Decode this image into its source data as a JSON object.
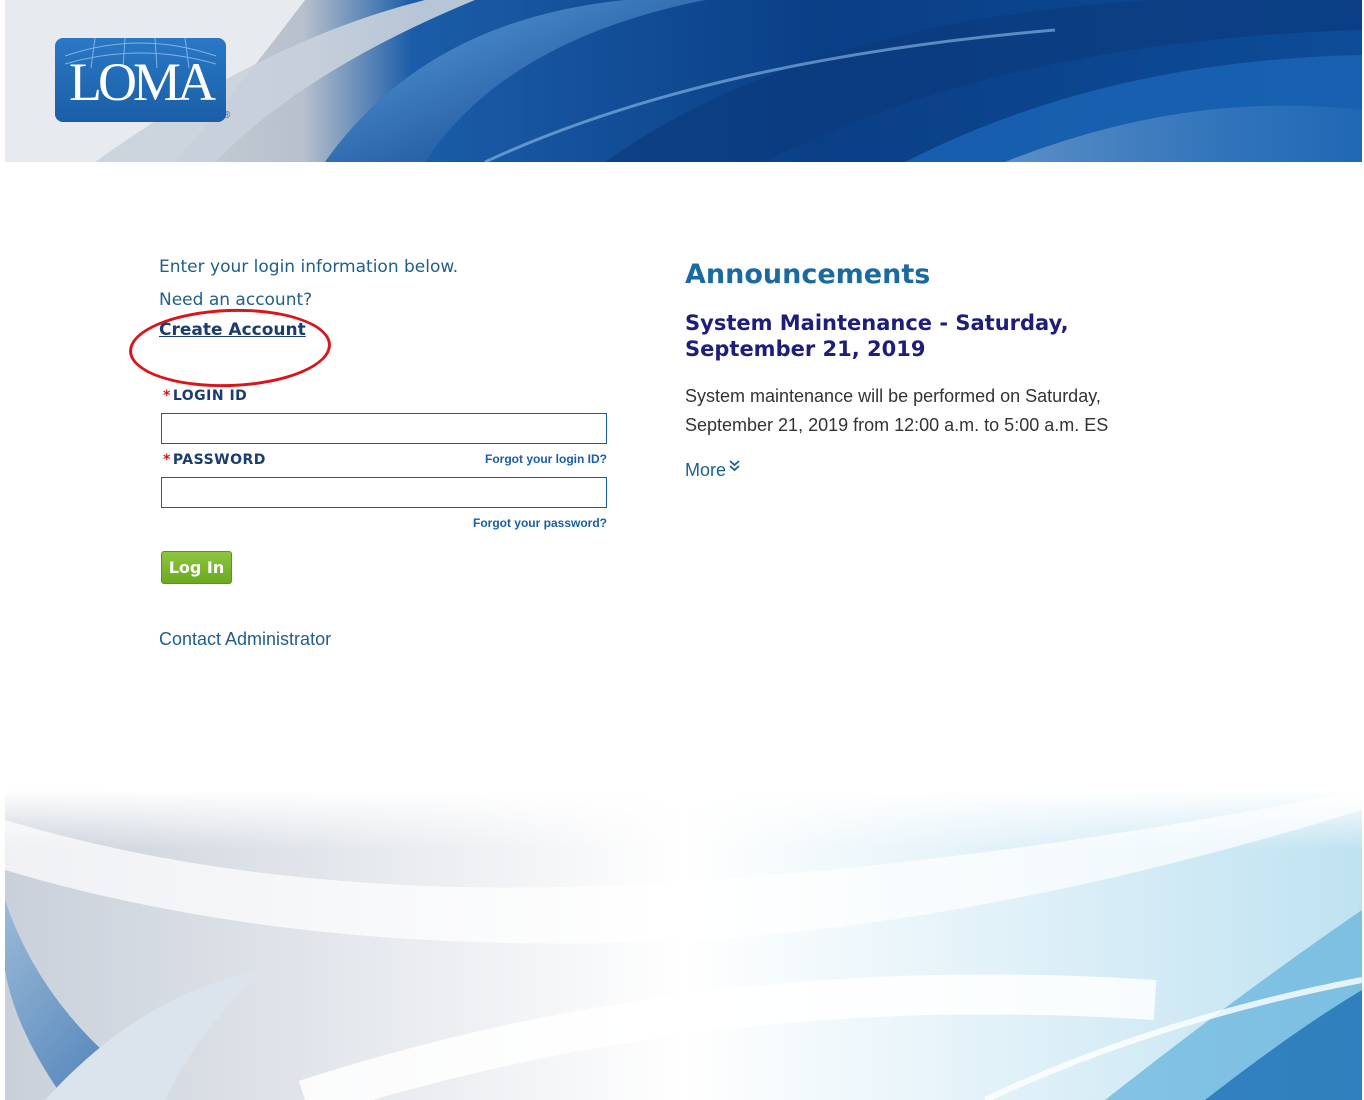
{
  "brand": {
    "logo_text": "LOMA",
    "reg_mark": "®"
  },
  "login": {
    "intro": "Enter your login information below.",
    "need_account": "Need an account?",
    "create_account": "Create Account",
    "login_id_label": "LOGIN ID",
    "password_label": "PASSWORD",
    "required_marker": "*",
    "login_id_value": "",
    "password_value": "",
    "forgot_login": "Forgot your login ID?",
    "forgot_password": "Forgot your password?",
    "login_button": "Log In",
    "contact_admin": "Contact Administrator"
  },
  "announcements": {
    "title": "Announcements",
    "items": [
      {
        "headline": "System Maintenance - Saturday, September 21, 2019",
        "body": "System maintenance will be performed on Saturday, September 21, 2019 from 12:00 a.m. to 5:00 a.m. ES",
        "more_label": "More",
        "more_icon": "double-chevron-down-icon"
      }
    ]
  },
  "colors": {
    "brand_blue": "#1a5ea6",
    "button_green": "#8cc63f",
    "highlight_red": "#d9141b",
    "headline_navy": "#1e1e7a"
  }
}
